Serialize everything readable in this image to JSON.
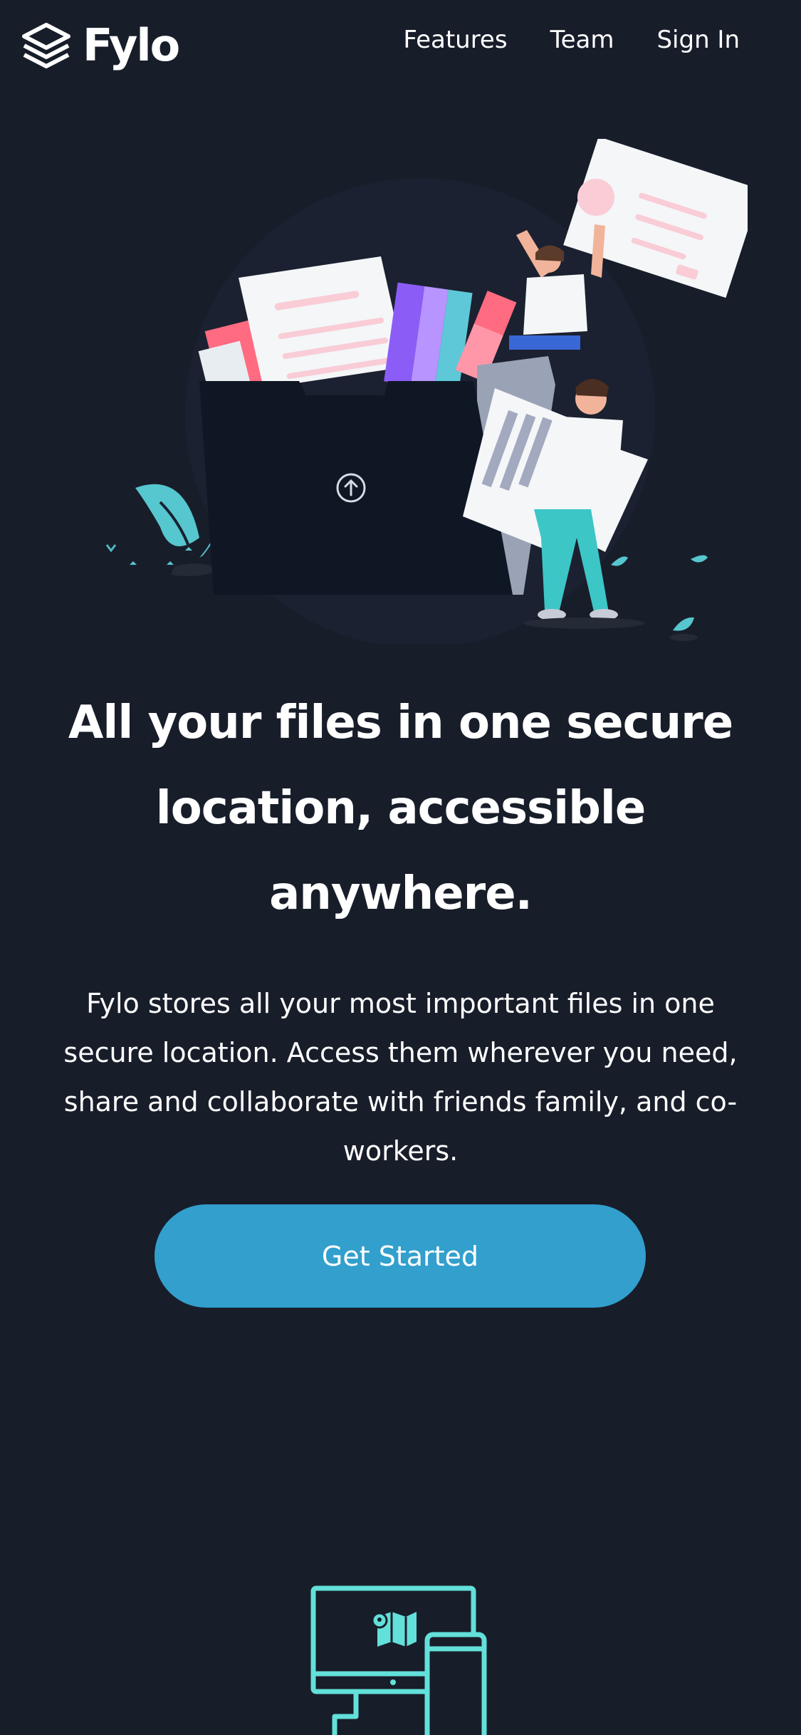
{
  "brand": {
    "name": "Fylo",
    "logo_icon": "stacked-layers-icon"
  },
  "nav": {
    "items": [
      {
        "label": "Features"
      },
      {
        "label": "Team"
      },
      {
        "label": "Sign In"
      }
    ]
  },
  "hero": {
    "illustration": "people-uploading-files-illustration",
    "upload_icon": "upload-arrow-icon",
    "headline": "All your files in one secure location, accessible anywhere.",
    "description": "Fylo stores all your most important files in one secure location. Access them wherever you need, share and collaborate with friends family, and co-workers.",
    "cta_label": "Get Started"
  },
  "features": {
    "first_icon": "devices-map-icon"
  },
  "colors": {
    "background": "#181d2a",
    "accent": "#329fcd",
    "icon_teal": "#62e0d9",
    "text": "#ffffff"
  }
}
